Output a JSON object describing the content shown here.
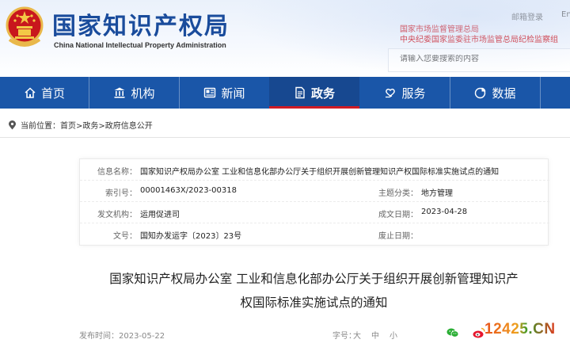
{
  "header": {
    "site_title": "国家知识产权局",
    "site_subtitle": "China National Intellectual Property Administration",
    "login_link": "邮箱登录",
    "english_link": "En",
    "red_link_1": "国家市场监督管理总局",
    "red_link_2": "中央纪委国家监委驻市场监管总局纪检监察组",
    "search_placeholder": "请输入您要搜索的内容"
  },
  "nav": {
    "items": [
      {
        "label": "首页",
        "icon": "home-icon"
      },
      {
        "label": "机构",
        "icon": "building-icon"
      },
      {
        "label": "新闻",
        "icon": "newspaper-icon"
      },
      {
        "label": "政务",
        "icon": "document-icon"
      },
      {
        "label": "服务",
        "icon": "heart-hand-icon"
      },
      {
        "label": "数据",
        "icon": "pie-chart-icon"
      }
    ],
    "active_index": 3
  },
  "breadcrumb": {
    "prefix": "当前位置：",
    "path": "首页>政务>政府信息公开"
  },
  "info_table": {
    "name_label": "信息名称：",
    "name_value": "国家知识产权局办公室 工业和信息化部办公厅关于组织开展创新管理知识产权国际标准实施试点的通知",
    "index_label": "索引号：",
    "index_value": "00001463X/2023-00318",
    "category_label": "主题分类：",
    "category_value": "地方管理",
    "issuer_label": "发文机构：",
    "issuer_value": "运用促进司",
    "date_label": "成文日期：",
    "date_value": "2023-04-28",
    "docno_label": "文号：",
    "docno_value": "国知办发运字〔2023〕23号",
    "abolish_label": "废止日期：",
    "abolish_value": ""
  },
  "article": {
    "title_line1": "国家知识产权局办公室 工业和信息化部办公厅关于组织开展创新管理知识产",
    "title_line2": "权国际标准实施试点的通知",
    "publish_label": "发布时间：",
    "publish_date": "2023-05-22",
    "font_size_label": "字号：",
    "font_large": "大",
    "font_medium": "中",
    "font_small": "小"
  },
  "watermark": "12425.CN",
  "colors": {
    "brand_blue": "#1a56a8",
    "title_blue": "#1a4c9c",
    "accent_red": "#d0121a"
  }
}
